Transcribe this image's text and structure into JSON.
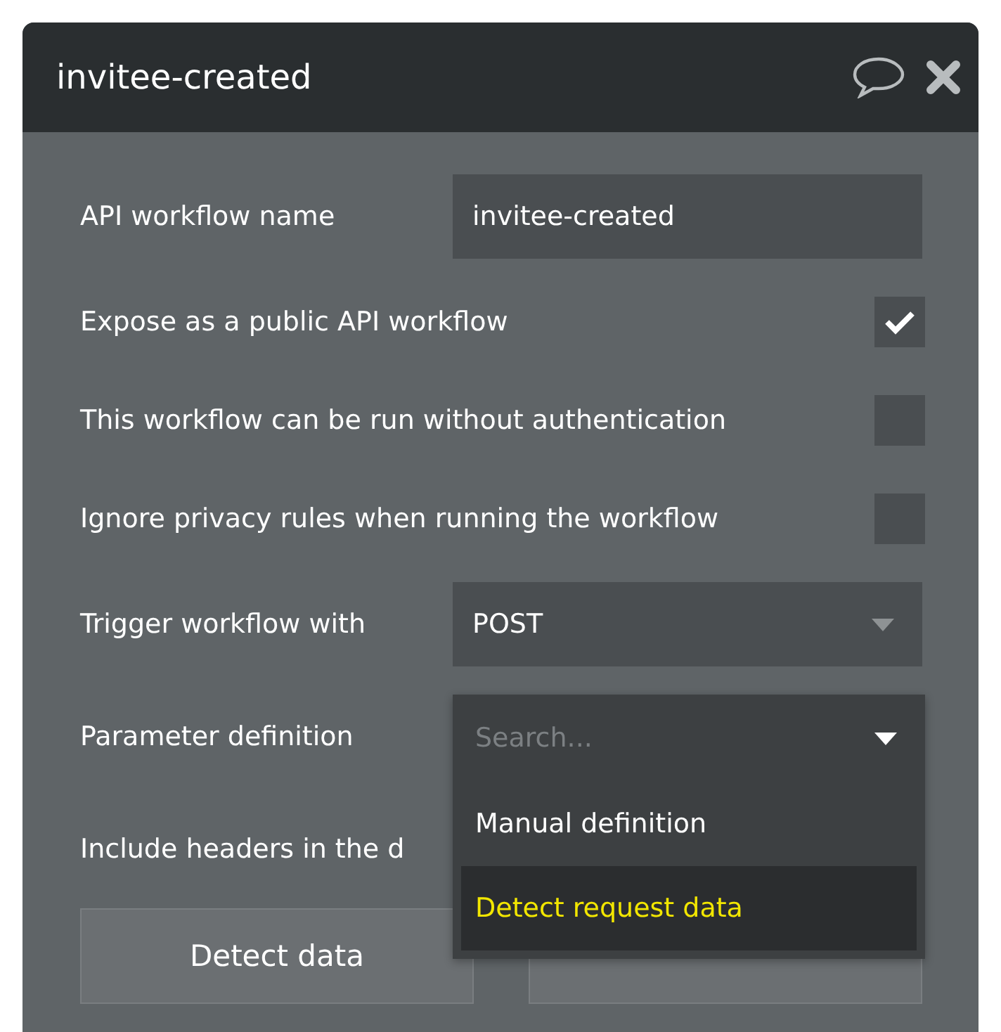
{
  "window": {
    "title": "invitee-created"
  },
  "fields": [
    {
      "kind": "text",
      "label": "API workflow name",
      "value": "invitee-created"
    },
    {
      "kind": "checkbox",
      "label": "Expose as a public API workflow",
      "checked": true
    },
    {
      "kind": "checkbox",
      "label": "This workflow can be run without authentication",
      "checked": false
    },
    {
      "kind": "checkbox",
      "label": "Ignore privacy rules when running the workflow",
      "checked": false
    },
    {
      "kind": "select",
      "label": "Trigger workflow with",
      "value": "POST"
    },
    {
      "kind": "dropdown",
      "label": "Parameter definition",
      "placeholder": "Search...",
      "options": [
        {
          "label": "Manual definition",
          "selected": false
        },
        {
          "label": "Detect request data",
          "selected": true
        }
      ]
    },
    {
      "kind": "plain",
      "label": "Include headers in the d"
    }
  ],
  "buttons": [
    {
      "kind": "labeled",
      "label": "Detect data"
    },
    {
      "kind": "blank"
    }
  ]
}
